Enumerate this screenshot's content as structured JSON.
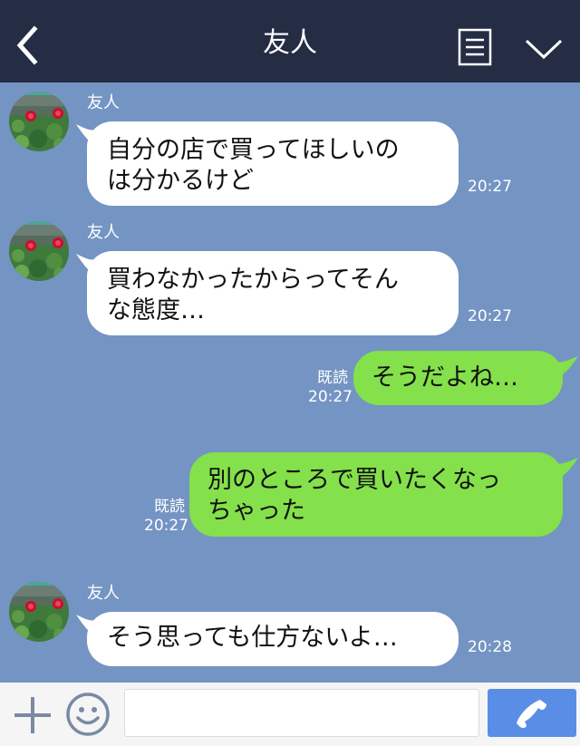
{
  "header": {
    "title": "友人",
    "icons": [
      "back-arrow-icon",
      "menu-list-icon",
      "chevron-down-icon"
    ]
  },
  "messages": [
    {
      "direction": "incoming",
      "sender": "友人",
      "text": "自分の店で買ってほしいの\nは分かるけど",
      "time": "20:27"
    },
    {
      "direction": "incoming",
      "sender": "友人",
      "text": "買わなかったからってそん\nな態度…",
      "time": "20:27"
    },
    {
      "direction": "outgoing",
      "read": "既読",
      "text": "そうだよね…",
      "time": "20:27"
    },
    {
      "direction": "outgoing",
      "read": "既読",
      "text": "別のところで買いたくなっ\nちゃった",
      "time": "20:27"
    },
    {
      "direction": "incoming",
      "sender": "友人",
      "text": "そう思っても仕方ないよ…",
      "time": "20:28"
    }
  ],
  "footer": {
    "input_value": "",
    "icons": [
      "plus-icon",
      "smiley-icon",
      "phone-icon"
    ]
  },
  "colors": {
    "header_bg": "#252d45",
    "chat_bg": "#7494c3",
    "incoming_bubble": "#ffffff",
    "outgoing_bubble": "#84e04b",
    "call_button": "#5a8ee6"
  }
}
